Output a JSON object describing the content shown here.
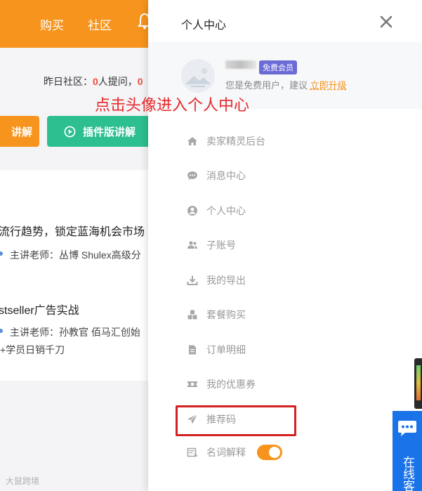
{
  "background": {
    "nav": {
      "buy": "购买",
      "community": "社区"
    },
    "stats": {
      "prefix": "昨日社区：",
      "questions_count": "0",
      "questions_label": "人提问，",
      "trailing_count": "0"
    },
    "buttons": {
      "orange_label": "讲解",
      "green_label": "插件版讲解"
    },
    "courses": [
      {
        "title": "流行趋势，锁定蓝海机会市场",
        "teacher": "主讲老师：丛博  Shulex高级分"
      },
      {
        "title": "stseller广告实战",
        "teacher": "主讲老师：孙教官  佰马汇创始",
        "teacher_extra": "+学员日销千刀"
      }
    ],
    "watermark": "大鼠跨境"
  },
  "drawer": {
    "title": "个人中心",
    "profile": {
      "vip_badge": "免费会员",
      "desc_prefix": "您是免费用户，建议",
      "upgrade_link": "立即升级"
    },
    "menu": [
      {
        "label": "卖家精灵后台",
        "icon": "home-icon"
      },
      {
        "label": "消息中心",
        "icon": "chat-bubble-icon"
      },
      {
        "label": "个人中心",
        "icon": "user-circle-icon"
      },
      {
        "label": "子账号",
        "icon": "users-icon"
      },
      {
        "label": "我的导出",
        "icon": "download-icon"
      },
      {
        "label": "套餐购买",
        "icon": "cubes-icon"
      },
      {
        "label": "订单明细",
        "icon": "document-icon"
      },
      {
        "label": "我的优惠券",
        "icon": "ticket-icon"
      },
      {
        "label": "推荐码",
        "icon": "paper-plane-icon"
      },
      {
        "label": "名词解释",
        "icon": "glossary-icon",
        "toggle_on": true
      }
    ]
  },
  "annotation": {
    "text": "点击头像进入个人中心"
  },
  "widgets": {
    "online_service": "在线客"
  },
  "colors": {
    "accent_orange": "#f7941d",
    "green": "#2ebf91",
    "annotation_red": "#e8272a",
    "vip_purple": "#6b6bd6",
    "service_blue": "#1a73e8"
  }
}
